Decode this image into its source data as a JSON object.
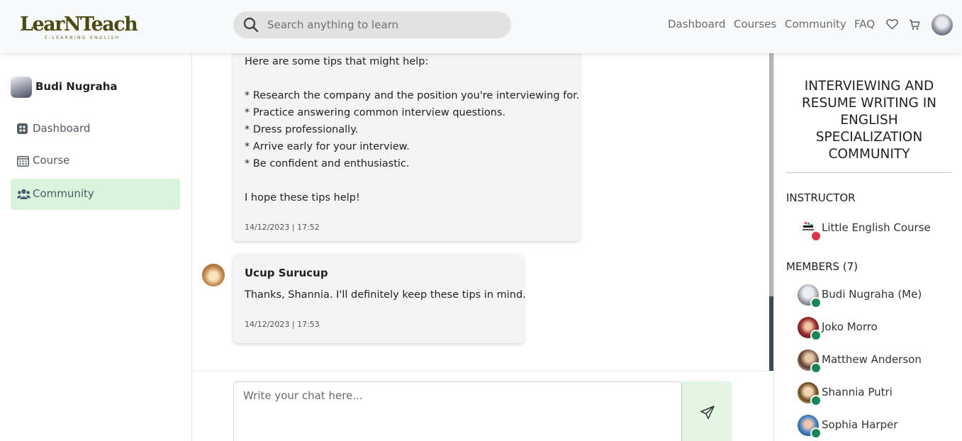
{
  "brand": {
    "logo_text": "LearNTeach",
    "logo_tagline": "E-LEARNING ENGLISH"
  },
  "header": {
    "search_placeholder": "Search anything to learn",
    "nav": [
      "Dashboard",
      "Courses",
      "Community",
      "FAQ"
    ],
    "icons": [
      "heart-icon",
      "cart-icon",
      "user-avatar"
    ]
  },
  "sidebar": {
    "user_name": "Budi Nugraha",
    "items": [
      {
        "label": "Dashboard",
        "icon": "dashboard-icon",
        "active": false
      },
      {
        "label": "Course",
        "icon": "calendar-icon",
        "active": false
      },
      {
        "label": "Community",
        "icon": "users-icon",
        "active": true
      }
    ]
  },
  "chat": {
    "messages": [
      {
        "lines": [
          "Here are some tips that might help:",
          "* Research the company and the position you're interviewing for.",
          "* Practice answering common interview questions.",
          "* Dress professionally.",
          "* Arrive early for your interview.",
          "* Be confident and enthusiastic.",
          "I hope these tips help!"
        ],
        "timestamp": "14/12/2023 | 17:52"
      },
      {
        "author": "Ucup Surucup",
        "text": "Thanks, Shannia. I'll definitely keep these tips in mind.",
        "timestamp": "14/12/2023 | 17:53"
      }
    ],
    "composer_placeholder": "Write your chat here..."
  },
  "community": {
    "title": "INTERVIEWING AND RESUME WRITING IN ENGLISH SPECIALIZATION COMMUNITY",
    "instructor_label": "INSTRUCTOR",
    "instructor": {
      "name": "Little English Course",
      "status_color": "#dc3545"
    },
    "members_label": "MEMBERS (7)",
    "members": [
      {
        "name": "Budi Nugraha (Me)",
        "status_color": "#198754"
      },
      {
        "name": "Joko Morro",
        "status_color": "#198754"
      },
      {
        "name": "Matthew Anderson",
        "status_color": "#198754"
      },
      {
        "name": "Shannia Putri",
        "status_color": "#198754"
      },
      {
        "name": "Sophia Harper",
        "status_color": "#198754"
      }
    ]
  },
  "colors": {
    "active_nav_bg": "#d9f4dd",
    "online": "#198754",
    "offline": "#dc3545",
    "brand": "#4a4a12"
  }
}
